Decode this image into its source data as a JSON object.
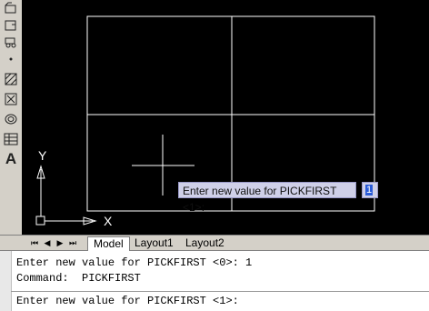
{
  "toolbar": {
    "tools": [
      "folder-open-icon",
      "folder-icon",
      "vehicle-icon",
      "point-icon",
      "hatch-icon",
      "gradient-icon",
      "region-icon",
      "table-icon",
      "text-tool-icon"
    ],
    "text_tool_glyph": "A"
  },
  "canvas": {
    "axis_y_label": "Y",
    "axis_x_label": "X"
  },
  "tooltip": {
    "prompt": "Enter new value for PICKFIRST <1>:",
    "input_value": "1"
  },
  "tabs": {
    "items": [
      {
        "label": "Model",
        "active": true
      },
      {
        "label": "Layout1",
        "active": false
      },
      {
        "label": "Layout2",
        "active": false
      }
    ]
  },
  "command": {
    "history": [
      "Enter new value for PICKFIRST <0>: 1",
      "Command:  PICKFIRST"
    ],
    "current": "Enter new value for PICKFIRST <1>:"
  },
  "colors": {
    "background": "#000000",
    "panel": "#d4d0c8",
    "tooltip_bg": "#cfd0e8"
  }
}
